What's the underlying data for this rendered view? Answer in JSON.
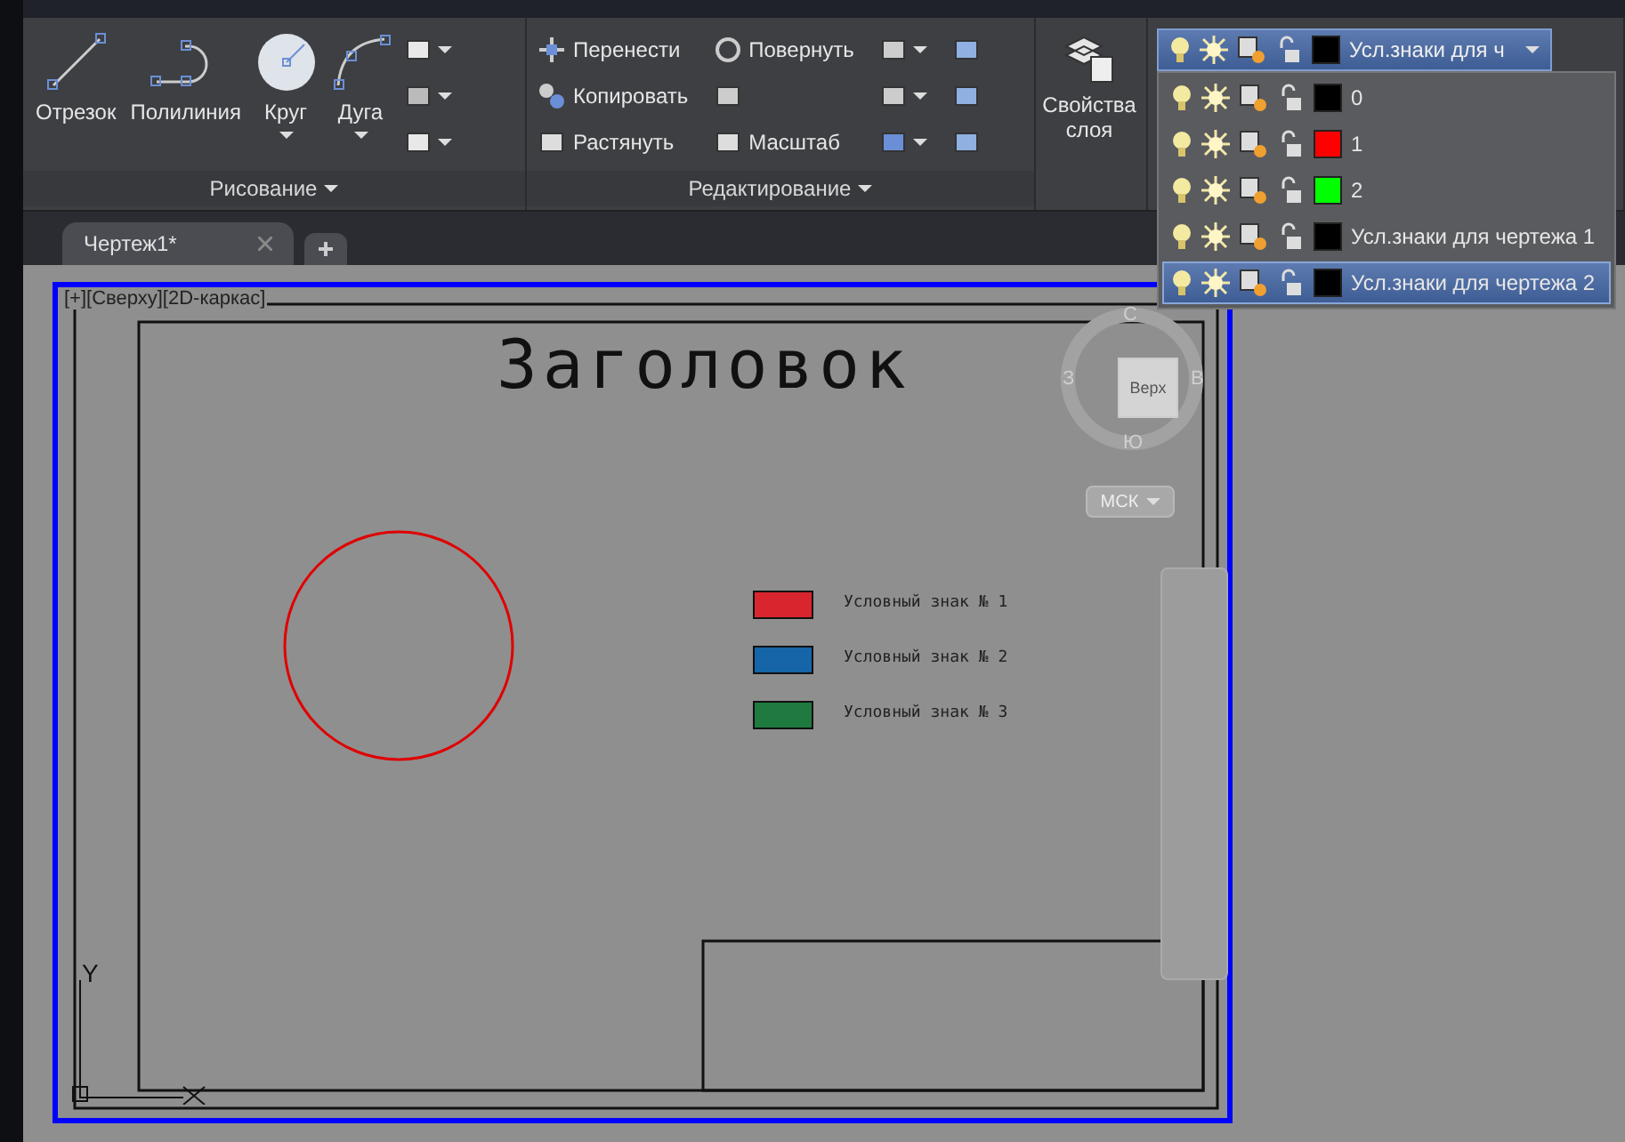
{
  "ribbon": {
    "draw_panel": {
      "title": "Рисование",
      "tools": [
        {
          "label": "Отрезок",
          "has_menu": false
        },
        {
          "label": "Полилиния",
          "has_menu": false
        },
        {
          "label": "Круг",
          "has_menu": true
        },
        {
          "label": "Дуга",
          "has_menu": true
        }
      ]
    },
    "modify_panel": {
      "title": "Редактирование",
      "tools": [
        "Перенести",
        "Повернуть",
        "Копировать",
        "Растянуть",
        "Масштаб"
      ]
    },
    "layer_properties": {
      "label": "Свойства слоя"
    },
    "layer_dropdown": {
      "current": "Усл.знаки для ч",
      "expanded": true,
      "items": [
        {
          "name": "0",
          "color": "#000000",
          "selected": false
        },
        {
          "name": "1",
          "color": "#ff0000",
          "selected": false
        },
        {
          "name": "2",
          "color": "#00ff00",
          "selected": false
        },
        {
          "name": "Усл.знаки для чертежа 1",
          "color": "#000000",
          "selected": false
        },
        {
          "name": "Усл.знаки для чертежа 2",
          "color": "#000000",
          "selected": true
        }
      ]
    }
  },
  "tabs": [
    {
      "label": "Чертеж1*",
      "selected": true
    }
  ],
  "viewport": {
    "label": "[+][Сверху][2D-каркас]",
    "title": "Заголовок",
    "legend": [
      {
        "label": "Условный знак № 1",
        "color": "#d9262e"
      },
      {
        "label": "Условный знак № 2",
        "color": "#1565a8"
      },
      {
        "label": "Условный знак № 3",
        "color": "#1e7a3e"
      }
    ],
    "viewcube": {
      "north": "С",
      "west": "З",
      "east": "В",
      "south": "Ю",
      "face": "Верх"
    },
    "ucs_menu": "МСК",
    "axis_y": "Y"
  }
}
